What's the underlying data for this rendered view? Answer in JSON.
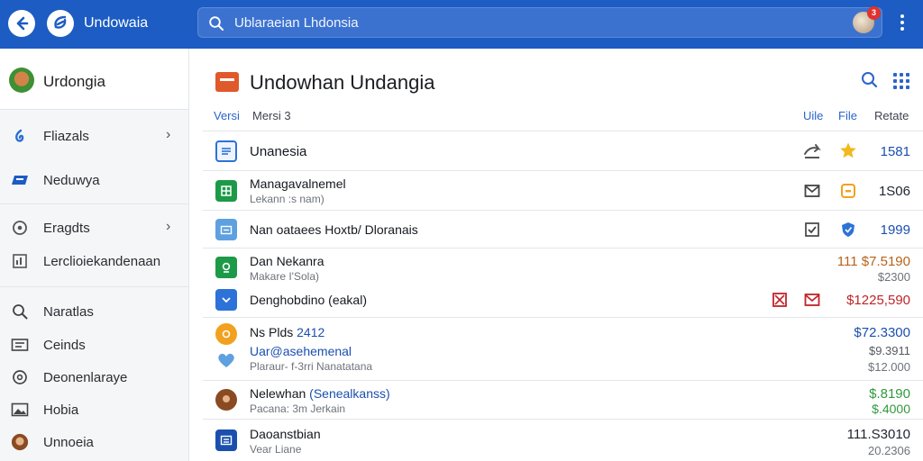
{
  "topbar": {
    "app_title": "Undowaia",
    "search_text": "Ublaraeian Lhdonsia",
    "notification_count": "3",
    "icons": {
      "back": "back-arrow-icon",
      "logo": "app-logo-icon",
      "search": "search-icon",
      "more": "more-vertical-icon"
    }
  },
  "sidebar": {
    "user_name": "Urdongia",
    "items": [
      {
        "label": "Fliazals",
        "icon": "drop-icon",
        "has_chevron": true
      },
      {
        "label": "Neduwya",
        "icon": "flag-icon",
        "has_chevron": false
      },
      {
        "label": "Eragdts",
        "icon": "clock-icon",
        "has_chevron": true
      },
      {
        "label": "Lerclioiekandenaan",
        "icon": "chart-icon",
        "has_chevron": false
      },
      {
        "label": "Naratlas",
        "icon": "search-icon",
        "has_chevron": false
      },
      {
        "label": "Ceinds",
        "icon": "card-icon",
        "has_chevron": false
      },
      {
        "label": "Deonenlaraye",
        "icon": "info-icon",
        "has_chevron": false
      },
      {
        "label": "Hobia",
        "icon": "image-icon",
        "has_chevron": false
      },
      {
        "label": "Unnoeia",
        "icon": "avatar-icon",
        "has_chevron": false
      }
    ]
  },
  "main": {
    "title": "Undowhan Undangia",
    "columns": {
      "left1": "Versi",
      "left2": "Mersi 3",
      "right1": "Uile",
      "right2": "File",
      "right3": "Retate"
    },
    "rows": [
      {
        "title": "Unanesia",
        "subtitle": "",
        "value": "1581",
        "value2": "",
        "color": "#1b4fae",
        "value_color": "#1b4fae"
      },
      {
        "title": "Managavalnemel",
        "subtitle": "Lekann :s nam)",
        "value": "1S06",
        "value2": "",
        "color": "#1d9a48",
        "value_color": "#1f2430"
      },
      {
        "title": "Nan oataees Hoxtb/ Dloranais",
        "subtitle": "",
        "value": "1999",
        "value2": "",
        "color": "#5ea0e0",
        "value_color": "#1b4fae"
      },
      {
        "title": "Dan Nekanra",
        "subtitle": "Makare I'Sola)",
        "value": "111 $7.5190",
        "value2": "$2300",
        "color": "#1d9a48",
        "value_color": "#b8631a"
      },
      {
        "title": "Denghobdino (eakal)",
        "subtitle": "",
        "value": "$1225,590",
        "value2": "",
        "color": "#2c72d8",
        "value_color": "#c0242a"
      },
      {
        "title": "Ns Plds",
        "title_accent": "2412",
        "subtitle": "",
        "value": "$72.3300",
        "value2": "$9.3911",
        "color": "#f2a11e",
        "value_color": "#1b4fae"
      },
      {
        "title": "Uar@asehemenal",
        "subtitle": "Plaraur- f-3rri Nanatatana",
        "value": "",
        "value2": "$12.000",
        "color": "#5ea0e0",
        "value_color": "#1b4fae"
      },
      {
        "title": "Nelewhan",
        "title_accent": "(Senealkanss)",
        "subtitle": "Pacana: 3m Jerkain",
        "value": "$.8190",
        "value2": "$.4000",
        "color": "#8a4a22",
        "value_color": "#2f9a3c"
      },
      {
        "title": "Daoanstbian",
        "subtitle": "Vear Liane",
        "value": "111.S3010",
        "value2": "20.2306",
        "color": "#1b4fae",
        "value_color": "#1f2430"
      }
    ]
  }
}
